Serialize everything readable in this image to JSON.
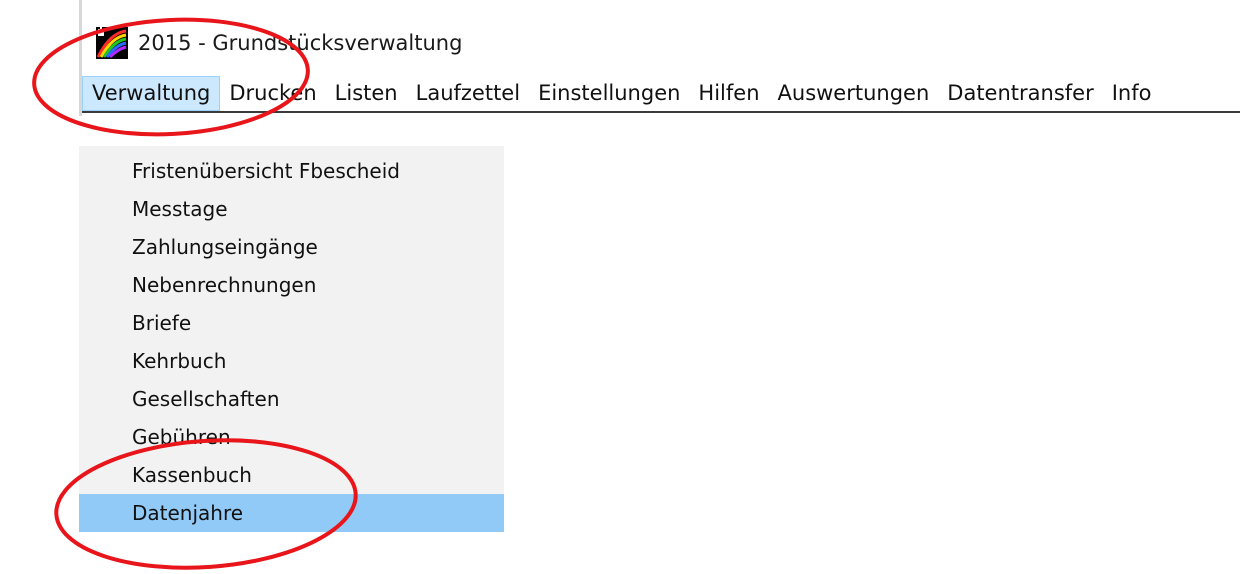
{
  "window": {
    "title": "2015 - Grundstücksverwaltung",
    "icon": "rainbow-app-icon"
  },
  "menubar": {
    "items": [
      {
        "label": "Verwaltung",
        "active": true
      },
      {
        "label": "Drucken"
      },
      {
        "label": "Listen"
      },
      {
        "label": "Laufzettel"
      },
      {
        "label": "Einstellungen"
      },
      {
        "label": "Hilfen"
      },
      {
        "label": "Auswertungen"
      },
      {
        "label": "Datentransfer"
      },
      {
        "label": "Info"
      }
    ]
  },
  "dropdown": {
    "items": [
      {
        "label": "Fristenübersicht Fbescheid"
      },
      {
        "label": "Messtage"
      },
      {
        "label": "Zahlungseingänge"
      },
      {
        "label": "Nebenrechnungen"
      },
      {
        "label": "Briefe"
      },
      {
        "label": "Kehrbuch"
      },
      {
        "label": "Gesellschaften"
      },
      {
        "label": "Gebühren"
      },
      {
        "label": "Kassenbuch"
      },
      {
        "label": "Datenjahre",
        "selected": true
      }
    ]
  },
  "colors": {
    "annotation": "#e8151b",
    "menu_active_bg": "#cce8ff",
    "selected_item_bg": "#91c9f7",
    "dropdown_bg": "#f2f2f2"
  }
}
